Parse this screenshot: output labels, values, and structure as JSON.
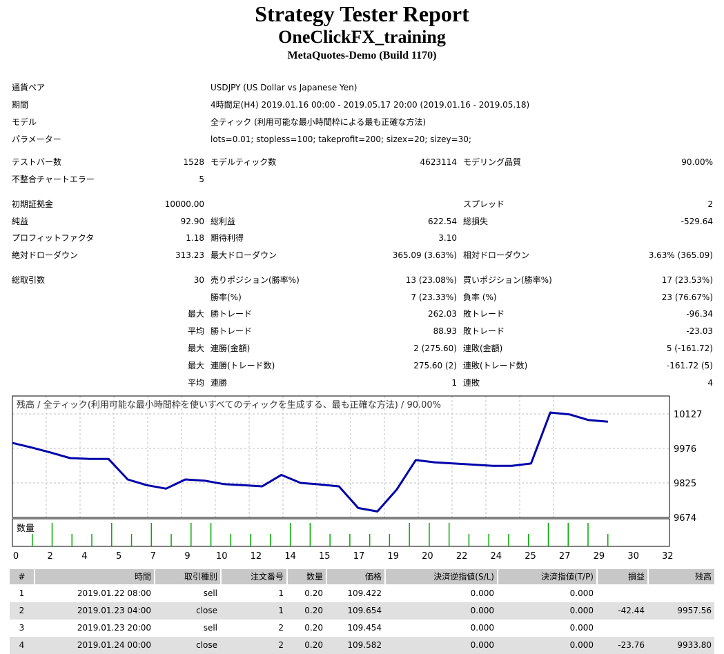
{
  "header": {
    "title": "Strategy Tester Report",
    "expert": "OneClickFX_training",
    "server": "MetaQuotes-Demo (Build 1170)"
  },
  "settings": {
    "symbol_label": "通貨ペア",
    "symbol_value": "USDJPY (US Dollar vs Japanese Yen)",
    "period_label": "期間",
    "period_value": "4時間足(H4) 2019.01.16 00:00 - 2019.05.17 20:00 (2019.01.16 - 2019.05.18)",
    "model_label": "モデル",
    "model_value": "全ティック (利用可能な最小時間枠による最も正確な方法)",
    "params_label": "パラメーター",
    "params_value": "lots=0.01; stopless=100; takeprofit=200; sizex=20; sizey=30;"
  },
  "quality": {
    "bars_label": "テストバー数",
    "bars_value": "1528",
    "ticks_label": "モデルティック数",
    "ticks_value": "4623114",
    "modeling_label": "モデリング品質",
    "modeling_value": "90.00%",
    "errors_label": "不整合チャートエラー",
    "errors_value": "5"
  },
  "stats": {
    "deposit_label": "初期証拠金",
    "deposit_value": "10000.00",
    "spread_label": "スプレッド",
    "spread_value": "2",
    "net_label": "純益",
    "net_value": "92.90",
    "gross_profit_label": "総利益",
    "gross_profit_value": "622.54",
    "gross_loss_label": "総損失",
    "gross_loss_value": "-529.64",
    "pf_label": "プロフィットファクタ",
    "pf_value": "1.18",
    "expected_label": "期待利得",
    "expected_value": "3.10",
    "abs_dd_label": "絶対ドローダウン",
    "abs_dd_value": "313.23",
    "max_dd_label": "最大ドローダウン",
    "max_dd_value": "365.09 (3.63%)",
    "rel_dd_label": "相対ドローダウン",
    "rel_dd_value": "3.63% (365.09)",
    "total_trades_label": "総取引数",
    "total_trades_value": "30",
    "short_label": "売りポジション(勝率%)",
    "short_value": "13 (23.08%)",
    "long_label": "買いポジション(勝率%)",
    "long_value": "17 (23.53%)",
    "win_rate_label": "勝率(%)",
    "win_rate_value": "7 (23.33%)",
    "loss_rate_label": "負率 (%)",
    "loss_rate_value": "23 (76.67%)",
    "q_max": "最大",
    "q_avg": "平均",
    "largest_win_label": "勝トレード",
    "largest_win_value": "262.03",
    "largest_loss_label": "敗トレード",
    "largest_loss_value": "-96.34",
    "avg_win_label": "勝トレード",
    "avg_win_value": "88.93",
    "avg_loss_label": "敗トレード",
    "avg_loss_value": "-23.03",
    "max_consec_win_label": "連勝(金額)",
    "max_consec_win_value": "2 (275.60)",
    "max_consec_loss_label": "連敗(金額)",
    "max_consec_loss_value": "5 (-161.72)",
    "max_consec_profit_label": "連勝(トレード数)",
    "max_consec_profit_value": "275.60 (2)",
    "max_consec_lossamt_label": "連敗(トレード数)",
    "max_consec_lossamt_value": "-161.72 (5)",
    "avg_consec_win_label": "連勝",
    "avg_consec_win_value": "1",
    "avg_consec_loss_label": "連敗",
    "avg_consec_loss_value": "4"
  },
  "chart_data": {
    "type": "line",
    "title": "残高 / 全ティック(利用可能な最小時間枠を使いすべてのティックを生成する、最も正確な方法) / 90.00%",
    "volume_label": "数量",
    "ylabel": "",
    "xlabel": "",
    "y_ticks": [
      "10127",
      "9976",
      "9825",
      "9674"
    ],
    "y_tick_values": [
      10127,
      9976,
      9825,
      9674
    ],
    "x_ticks": [
      "0",
      "2",
      "4",
      "5",
      "7",
      "9",
      "10",
      "12",
      "14",
      "15",
      "17",
      "19",
      "20",
      "22",
      "24",
      "25",
      "27",
      "29",
      "30",
      "32"
    ],
    "ylim": [
      9674,
      10127
    ],
    "balance": [
      {
        "x": 0,
        "y": 10000
      },
      {
        "x": 1,
        "y": 9980
      },
      {
        "x": 2,
        "y": 9957.56
      },
      {
        "x": 3,
        "y": 9933.8
      },
      {
        "x": 4,
        "y": 9930
      },
      {
        "x": 5,
        "y": 9930
      },
      {
        "x": 6,
        "y": 9840
      },
      {
        "x": 7,
        "y": 9815
      },
      {
        "x": 8,
        "y": 9800
      },
      {
        "x": 9,
        "y": 9840
      },
      {
        "x": 10,
        "y": 9835
      },
      {
        "x": 11,
        "y": 9820
      },
      {
        "x": 12,
        "y": 9815
      },
      {
        "x": 13,
        "y": 9810
      },
      {
        "x": 14,
        "y": 9860
      },
      {
        "x": 15,
        "y": 9825
      },
      {
        "x": 16,
        "y": 9818
      },
      {
        "x": 17,
        "y": 9810
      },
      {
        "x": 18,
        "y": 9715
      },
      {
        "x": 19,
        "y": 9700
      },
      {
        "x": 20,
        "y": 9795
      },
      {
        "x": 21,
        "y": 9925
      },
      {
        "x": 22,
        "y": 9915
      },
      {
        "x": 23,
        "y": 9910
      },
      {
        "x": 24,
        "y": 9905
      },
      {
        "x": 25,
        "y": 9900
      },
      {
        "x": 26,
        "y": 9900
      },
      {
        "x": 27,
        "y": 9910
      },
      {
        "x": 28,
        "y": 10133
      },
      {
        "x": 29,
        "y": 10125
      },
      {
        "x": 30,
        "y": 10100
      },
      {
        "x": 31,
        "y": 10093
      }
    ],
    "volume": [
      {
        "x": 1,
        "v": 0.01
      },
      {
        "x": 2,
        "v": 0.02
      },
      {
        "x": 3,
        "v": 0.01
      },
      {
        "x": 4,
        "v": 0.01
      },
      {
        "x": 5,
        "v": 0.02
      },
      {
        "x": 6,
        "v": 0.01
      },
      {
        "x": 7,
        "v": 0.02
      },
      {
        "x": 8,
        "v": 0.01
      },
      {
        "x": 9,
        "v": 0.02
      },
      {
        "x": 10,
        "v": 0.02
      },
      {
        "x": 11,
        "v": 0.01
      },
      {
        "x": 12,
        "v": 0.01
      },
      {
        "x": 13,
        "v": 0.01
      },
      {
        "x": 14,
        "v": 0.02
      },
      {
        "x": 15,
        "v": 0.02
      },
      {
        "x": 16,
        "v": 0.01
      },
      {
        "x": 17,
        "v": 0.01
      },
      {
        "x": 18,
        "v": 0.01
      },
      {
        "x": 19,
        "v": 0.01
      },
      {
        "x": 20,
        "v": 0.02
      },
      {
        "x": 21,
        "v": 0.02
      },
      {
        "x": 22,
        "v": 0.02
      },
      {
        "x": 23,
        "v": 0.01
      },
      {
        "x": 24,
        "v": 0.01
      },
      {
        "x": 25,
        "v": 0.01
      },
      {
        "x": 26,
        "v": 0.01
      },
      {
        "x": 27,
        "v": 0.02
      },
      {
        "x": 28,
        "v": 0.02
      },
      {
        "x": 29,
        "v": 0.02
      },
      {
        "x": 30,
        "v": 0.01
      }
    ],
    "line_color": "#0000aa",
    "volume_color": "#00aa00"
  },
  "trades": {
    "headers": [
      "#",
      "時間",
      "取引種別",
      "注文番号",
      "数量",
      "価格",
      "決済逆指値(S/L)",
      "決済指値(T/P)",
      "損益",
      "残高"
    ],
    "rows": [
      [
        "1",
        "2019.01.22 08:00",
        "sell",
        "1",
        "0.20",
        "109.422",
        "0.000",
        "0.000",
        "",
        ""
      ],
      [
        "2",
        "2019.01.23 04:00",
        "close",
        "1",
        "0.20",
        "109.654",
        "0.000",
        "0.000",
        "-42.44",
        "9957.56"
      ],
      [
        "3",
        "2019.01.23 20:00",
        "sell",
        "2",
        "0.20",
        "109.454",
        "0.000",
        "0.000",
        "",
        ""
      ],
      [
        "4",
        "2019.01.24 00:00",
        "close",
        "2",
        "0.20",
        "109.582",
        "0.000",
        "0.000",
        "-23.76",
        "9933.80"
      ]
    ]
  }
}
